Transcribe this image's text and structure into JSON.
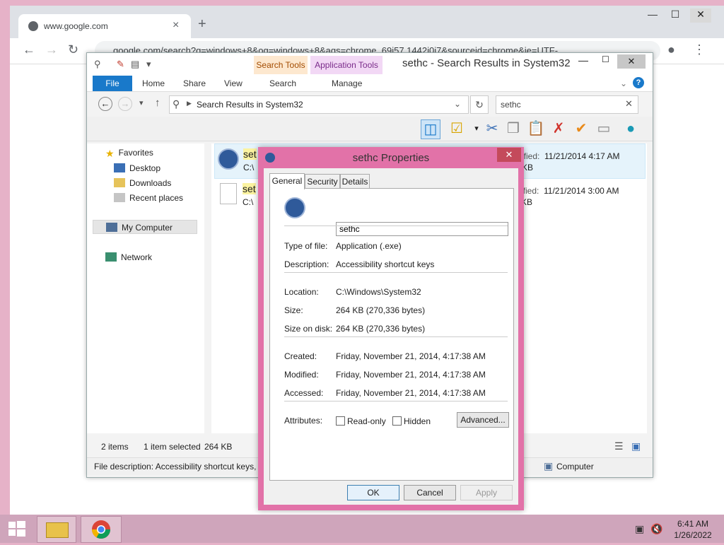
{
  "chrome": {
    "tab_title": "www.google.com",
    "tab_close": "×",
    "new_tab": "+",
    "minimize": "—",
    "maximize": "☐",
    "close": "✕",
    "url": "google.com/search?q=windows+8&oq=windows+8&aqs=chrome..69i57.1442j0j7&sourceid=chrome&ie=UTF-"
  },
  "explorer": {
    "title": "sethc - Search Results in System32",
    "context_tabs": [
      "Search Tools",
      "Application Tools"
    ],
    "ribbon_tabs": [
      "File",
      "Home",
      "Share",
      "View",
      "Search",
      "Manage"
    ],
    "breadcrumb": "Search Results in System32",
    "search_value": "sethc",
    "nav": {
      "favorites": "Favorites",
      "desktop": "Desktop",
      "downloads": "Downloads",
      "recent": "Recent places",
      "computer": "My Computer",
      "network": "Network"
    },
    "rows": [
      {
        "name_partial": "set",
        "path_partial": "C:\\",
        "modified_partial": "ified:",
        "modified": "11/21/2014 4:17 AM",
        "size_partial": "KB"
      },
      {
        "name_partial": "set",
        "path_partial": "C:\\",
        "modified_partial": "ified:",
        "modified": "11/21/2014 3:00 AM",
        "size_partial": "KB"
      }
    ],
    "status": {
      "items": "2 items",
      "selected": "1 item selected",
      "size": "264 KB",
      "file_description": "File description: Accessibility shortcut keys, C",
      "zone": "Computer"
    }
  },
  "dialog": {
    "title": "sethc Properties",
    "close": "✕",
    "tabs": [
      "General",
      "Security",
      "Details"
    ],
    "name": "sethc",
    "fields": {
      "type_label": "Type of file:",
      "type": "Application (.exe)",
      "desc_label": "Description:",
      "desc": "Accessibility shortcut keys",
      "loc_label": "Location:",
      "loc": "C:\\Windows\\System32",
      "size_label": "Size:",
      "size": "264 KB (270,336 bytes)",
      "disk_label": "Size on disk:",
      "disk": "264 KB (270,336 bytes)",
      "created_label": "Created:",
      "created": "Friday, November 21, 2014, 4:17:38 AM",
      "modified_label": "Modified:",
      "modified": "Friday, November 21, 2014, 4:17:38 AM",
      "accessed_label": "Accessed:",
      "accessed": "Friday, November 21, 2014, 4:17:38 AM",
      "attr_label": "Attributes:",
      "readonly": "Read-only",
      "hidden": "Hidden",
      "advanced": "Advanced..."
    },
    "buttons": {
      "ok": "OK",
      "cancel": "Cancel",
      "apply": "Apply"
    }
  },
  "taskbar": {
    "time": "6:41 AM",
    "date": "1/26/2022"
  },
  "colors": {
    "desktop": "#e6b2c8",
    "dialog_frame": "#e272a8",
    "file_tab": "#1979ca",
    "selection": "#e5f3fb"
  }
}
